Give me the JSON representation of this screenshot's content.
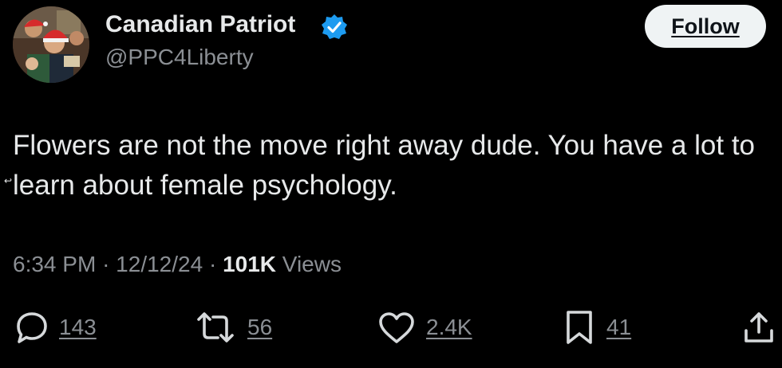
{
  "tweet": {
    "author": {
      "display_name": "Canadian Patriot",
      "handle": "@PPC4Liberty",
      "verified_icon": "verified-badge-icon",
      "avatar": "profile-photo"
    },
    "follow_label": "Follow",
    "text": "Flowers are not the move right away dude. You have a lot to learn about female psychology.",
    "cursor_glyph": "↩",
    "meta": {
      "time": "6:34 PM",
      "separator": "·",
      "date": "12/12/24",
      "views_count": "101K",
      "views_label": "Views"
    },
    "actions": {
      "replies": {
        "icon": "reply-icon",
        "count": "143"
      },
      "reposts": {
        "icon": "repost-icon",
        "count": "56"
      },
      "likes": {
        "icon": "heart-icon",
        "count": "2.4K"
      },
      "bookmarks": {
        "icon": "bookmark-icon",
        "count": "41"
      },
      "share": {
        "icon": "share-icon"
      }
    }
  },
  "colors": {
    "background": "#000000",
    "primary_text": "#e7e9ea",
    "secondary_text": "#8b8f94",
    "verified_blue": "#1d9bf0",
    "follow_button_bg": "#eff3f4",
    "follow_button_text": "#0f1419"
  }
}
